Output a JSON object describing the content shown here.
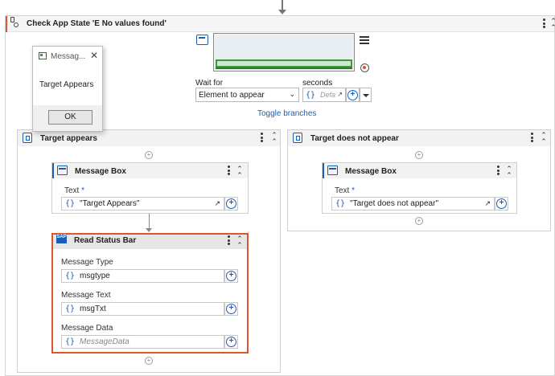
{
  "activity": {
    "title": "Check App State 'E No values found'"
  },
  "wait": {
    "label": "Wait for",
    "value": "Element to appear",
    "seconds_label": "seconds",
    "seconds_placeholder": "Defa"
  },
  "toggle_branches": "Toggle branches",
  "dialog": {
    "title": "Messag...",
    "text": "Target Appears",
    "ok": "OK"
  },
  "left_branch": {
    "title": "Target appears",
    "message_box": {
      "title": "Message Box",
      "text_label": "Text",
      "text_value": "\"Target Appears\""
    },
    "read_status_bar": {
      "title": "Read Status Bar",
      "fields": [
        {
          "label": "Message Type",
          "value": "msgtype"
        },
        {
          "label": "Message Text",
          "value": "msgTxt"
        },
        {
          "label": "Message Data",
          "placeholder": "MessageData"
        }
      ]
    }
  },
  "right_branch": {
    "title": "Target does not appear",
    "message_box": {
      "title": "Message Box",
      "text_label": "Text",
      "text_value": "\"Target does not appear\""
    }
  },
  "colors": {
    "accent": "#1a5fb4",
    "selection_border": "#e0542b",
    "header_marker": "#e0542b"
  }
}
